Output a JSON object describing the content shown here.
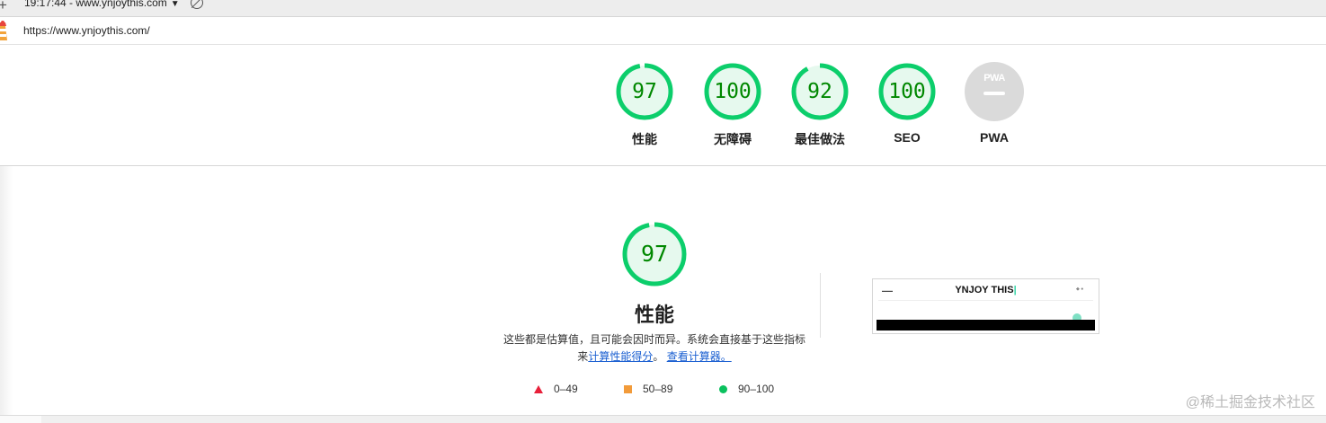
{
  "topbar": {
    "report_selector": "19:17:44 - www.ynjoythis.com",
    "new_icon": "plus-icon",
    "clear_icon": "block-icon"
  },
  "urlbar": {
    "url": "https://www.ynjoythis.com/",
    "logo_icon": "lighthouse-icon"
  },
  "scores": [
    {
      "label": "性能",
      "score": "97",
      "value": 97
    },
    {
      "label": "无障碍",
      "score": "100",
      "value": 100
    },
    {
      "label": "最佳做法",
      "score": "92",
      "value": 92
    },
    {
      "label": "SEO",
      "score": "100",
      "value": 100
    },
    {
      "label": "PWA",
      "badge": "PWA"
    }
  ],
  "performance": {
    "score": "97",
    "value": 97,
    "title": "性能",
    "desc_text": "这些都是估算值，且可能会因时而异。系统会直接基于这些指标来",
    "link_calc": "计算性能得分",
    "desc_mid": "。",
    "link_calculator": "查看计算器。"
  },
  "screenshot_thumb": {
    "site_title": "YNJOY THIS",
    "title_accent": "|"
  },
  "legend": [
    {
      "shape": "triangle",
      "range": "0–49",
      "color": "#e8203a"
    },
    {
      "shape": "square",
      "range": "50–89",
      "color": "#f29b3a"
    },
    {
      "shape": "circle",
      "range": "90–100",
      "color": "#0ac15e"
    }
  ],
  "colors": {
    "pass_ring": "#0cce6b",
    "pass_fill": "#e6f9ee",
    "pass_text": "#008800",
    "link": "#1a5fd1"
  },
  "watermark": "@稀土掘金技术社区"
}
